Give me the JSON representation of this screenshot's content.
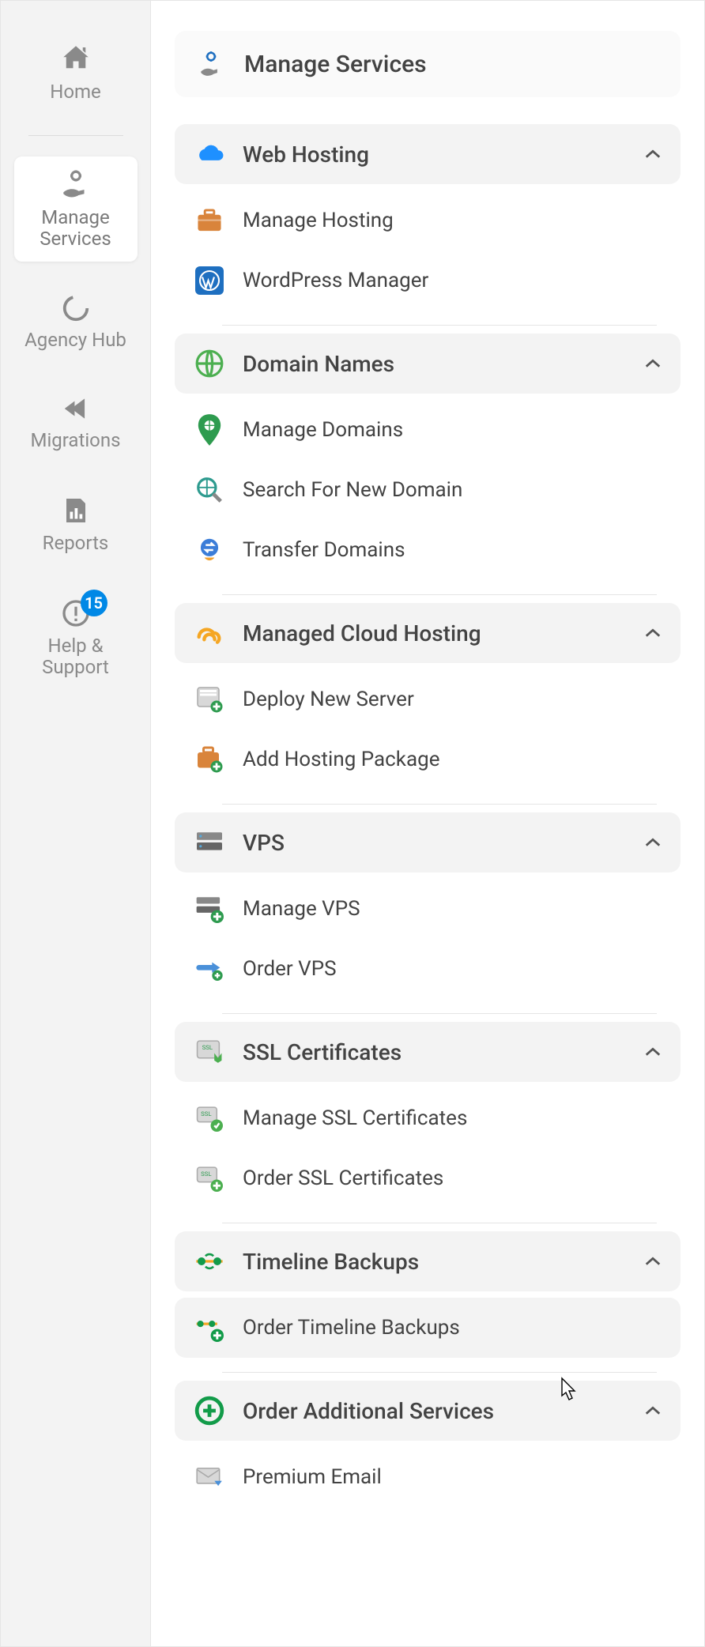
{
  "sidebar": {
    "items": [
      {
        "label": "Home",
        "icon": "home-icon"
      },
      {
        "label": "Manage Services",
        "icon": "manage-services-icon",
        "active": true
      },
      {
        "label": "Agency Hub",
        "icon": "agency-hub-icon"
      },
      {
        "label": "Migrations",
        "icon": "migrations-icon"
      },
      {
        "label": "Reports",
        "icon": "reports-icon"
      },
      {
        "label": "Help & Support",
        "icon": "help-icon",
        "badge": "15"
      }
    ]
  },
  "page": {
    "title": "Manage Services"
  },
  "sections": [
    {
      "title": "Web Hosting",
      "icon": "cloud-icon",
      "icon_color": "#1e90ff",
      "items": [
        {
          "label": "Manage Hosting",
          "icon": "briefcase-icon",
          "icon_color": "#d9843b"
        },
        {
          "label": "WordPress Manager",
          "icon": "wordpress-icon",
          "icon_color": "#1e6fc0"
        }
      ]
    },
    {
      "title": "Domain Names",
      "icon": "globe-icon",
      "icon_color": "#4caf50",
      "items": [
        {
          "label": "Manage Domains",
          "icon": "pin-globe-icon",
          "icon_color": "#2e9b4f"
        },
        {
          "label": "Search For New Domain",
          "icon": "search-globe-icon",
          "icon_color": "#2e9b8f"
        },
        {
          "label": "Transfer Domains",
          "icon": "transfer-icon",
          "icon_color": "#f0a030"
        }
      ]
    },
    {
      "title": "Managed Cloud Hosting",
      "icon": "cloud-swirl-icon",
      "icon_color": "#f5a623",
      "items": [
        {
          "label": "Deploy New Server",
          "icon": "server-add-icon",
          "icon_color": "#8a8a8a"
        },
        {
          "label": "Add Hosting Package",
          "icon": "briefcase-add-icon",
          "icon_color": "#d9843b"
        }
      ]
    },
    {
      "title": "VPS",
      "icon": "vps-icon",
      "icon_color": "#707070",
      "items": [
        {
          "label": "Manage VPS",
          "icon": "vps-manage-icon",
          "icon_color": "#707070"
        },
        {
          "label": "Order VPS",
          "icon": "vps-order-icon",
          "icon_color": "#4a90d9"
        }
      ]
    },
    {
      "title": "SSL Certificates",
      "icon": "ssl-icon",
      "icon_color": "#4caf50",
      "items": [
        {
          "label": "Manage SSL Certificates",
          "icon": "ssl-manage-icon",
          "icon_color": "#4caf50"
        },
        {
          "label": "Order SSL Certificates",
          "icon": "ssl-order-icon",
          "icon_color": "#4caf50"
        }
      ]
    },
    {
      "title": "Timeline Backups",
      "icon": "timeline-icon",
      "icon_color": "#129b49",
      "items": [
        {
          "label": "Order Timeline Backups",
          "icon": "timeline-add-icon",
          "icon_color": "#129b49",
          "hover": true
        }
      ]
    },
    {
      "title": "Order Additional Services",
      "icon": "plus-circle-icon",
      "icon_color": "#129b49",
      "items": [
        {
          "label": "Premium Email",
          "icon": "mail-icon",
          "icon_color": "#8a8a8a"
        }
      ]
    }
  ]
}
